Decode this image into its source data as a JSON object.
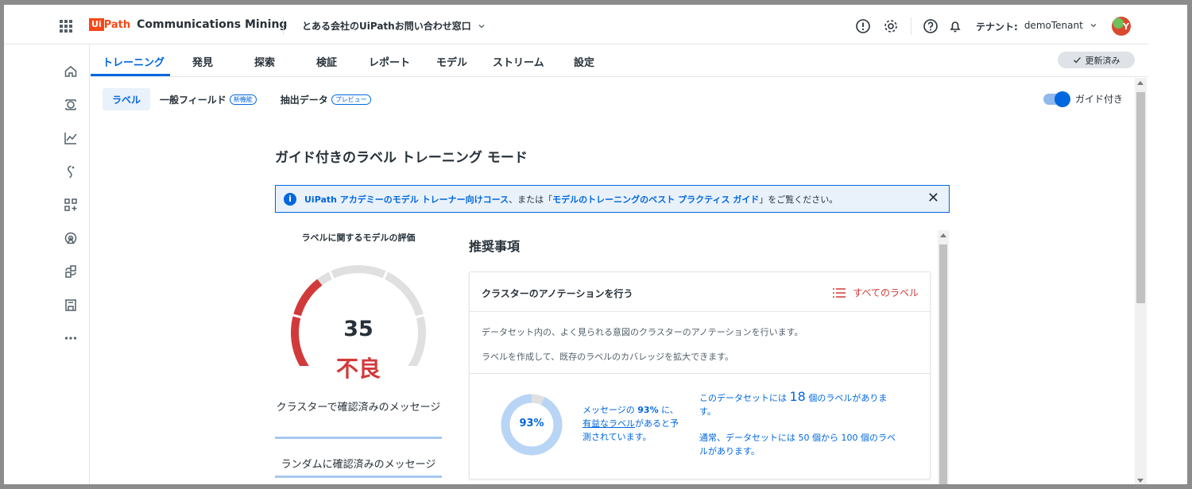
{
  "app": {
    "brand_ui": "Ui",
    "brand_path": "Path",
    "product": "Communications Mining",
    "dataset": "とある会社のUiPathお問い合わせ窓口",
    "tenant_label": "テナント:",
    "tenant_name": "demoTenant",
    "avatar_initial": "Y"
  },
  "nav": {
    "tabs": [
      "トレーニング",
      "発見",
      "探索",
      "検証",
      "レポート",
      "モデル",
      "ストリーム",
      "設定"
    ],
    "updated_label": "更新済み"
  },
  "subtabs": {
    "labels": "ラベル",
    "general_fields": "一般フィールド",
    "general_badge": "新機能",
    "extraction": "抽出データ",
    "extraction_badge": "プレビュー",
    "guided_toggle": "ガイド付き"
  },
  "main": {
    "title": "ガイド付きのラベル トレーニング モード",
    "info_link1": "UiPath アカデミーのモデル トレーナー向けコース",
    "info_mid": "、または「",
    "info_link2": "モデルのトレーニングのベスト プラクティス ガイド",
    "info_end": "」をご覧ください。"
  },
  "evaluation": {
    "title": "ラベルに関するモデルの評価",
    "score": "35",
    "grade": "不良",
    "item1": "クラスターで確認済みのメッセージ",
    "item2": "ランダムに確認済みのメッセージ"
  },
  "recommendations": {
    "title": "推奨事項",
    "card_title": "クラスターのアノテーションを行う",
    "all_labels": "すべてのラベル",
    "desc1": "データセット内の、よく見られる意図のクラスターのアノテーションを行います。",
    "desc2": "ラベルを作成して、既存のラベルのカバレッジを拡大できます。",
    "coverage_pct": "93%",
    "coverage_value": 93,
    "coverage_pre": "メッセージの ",
    "coverage_mid": " に、",
    "coverage_link": "有益なラベル",
    "coverage_post1": "があると予",
    "coverage_post2": "測されています。",
    "label_count_pre": "このデータセットには ",
    "label_count": "18",
    "label_count_post1": " 個のラベルがありま",
    "label_count_post2": "す。",
    "typical1": "通常、データセットには 50 個から 100 個のラベ",
    "typical2": "ルがあります。"
  },
  "colors": {
    "accent": "#0067df",
    "danger": "#d13a3a",
    "gauge_track": "#e0e0e0"
  }
}
